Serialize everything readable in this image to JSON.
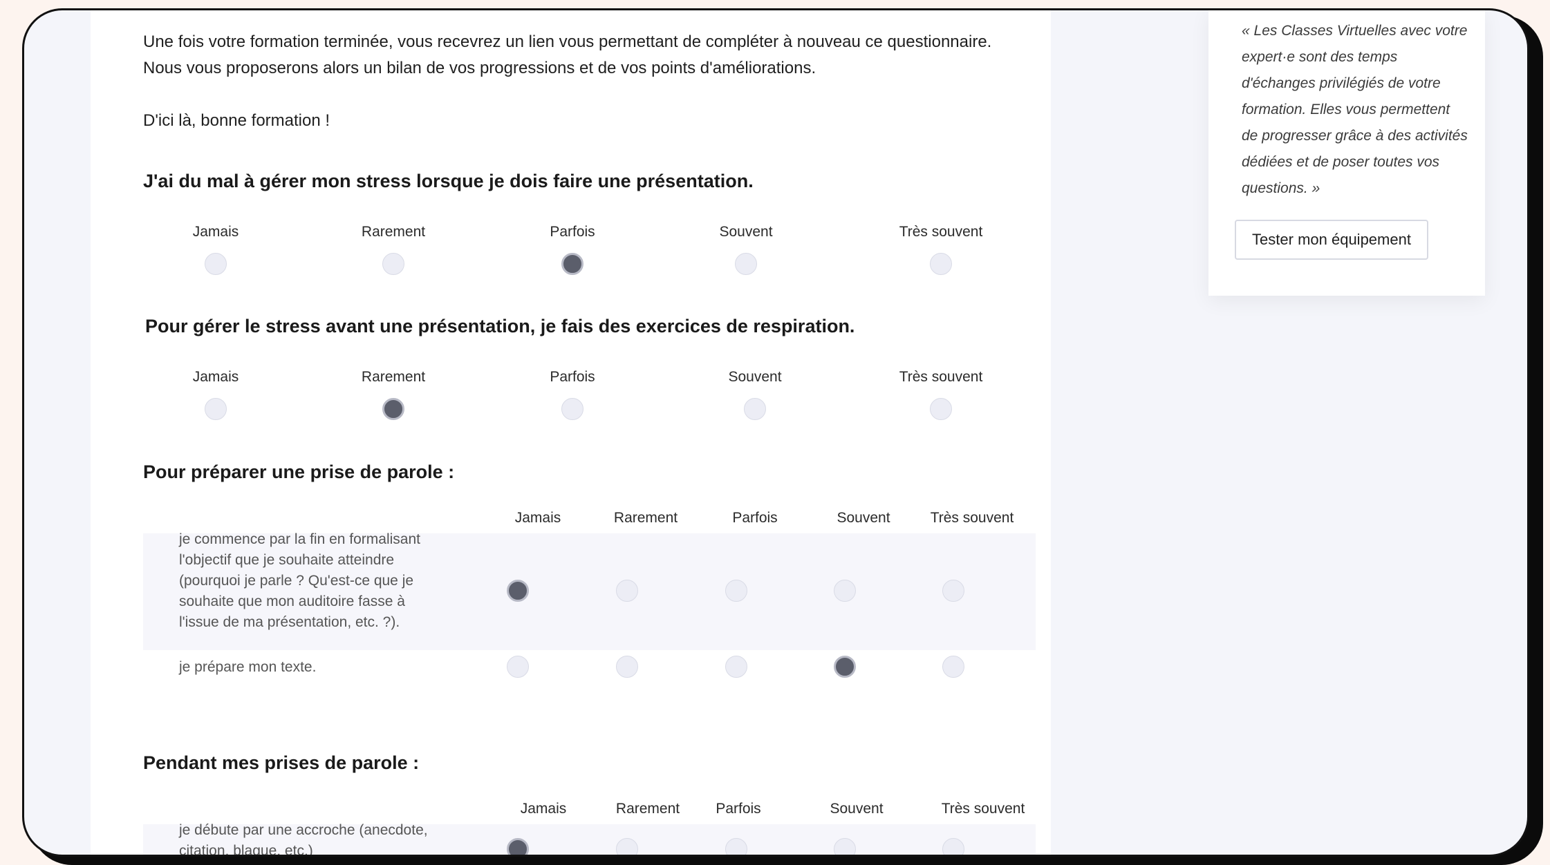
{
  "intro": {
    "line1": "Une fois votre formation terminée, vous recevrez un lien vous permettant de compléter à nouveau ce questionnaire.",
    "line2": "Nous vous proposerons alors un bilan de vos progressions et de vos points d'améliorations.",
    "line3": "D'ici là, bonne formation !"
  },
  "options": [
    "Jamais",
    "Rarement",
    "Parfois",
    "Souvent",
    "Très souvent"
  ],
  "q1": {
    "title": "J'ai du mal à gérer mon stress lorsque je dois faire une présentation.",
    "selected": "Parfois"
  },
  "q2": {
    "title": "Pour gérer le stress avant une présentation, je fais des exercices de respiration.",
    "selected": "Rarement"
  },
  "q3": {
    "title": "Pour préparer une prise de parole :",
    "rows": [
      {
        "text": "je commence par la fin en formalisant l'objectif que je souhaite atteindre (pourquoi je parle ? Qu'est-ce que je souhaite que mon auditoire fasse à l'issue de ma présentation, etc. ?).",
        "selected": "Jamais"
      },
      {
        "text": "je prépare mon texte.",
        "selected": "Souvent"
      }
    ]
  },
  "q4": {
    "title": "Pendant mes prises de parole :",
    "rows": [
      {
        "text": "je débute par une accroche (anecdote, citation, blague, etc.)",
        "selected": "Jamais"
      }
    ]
  },
  "sidebar": {
    "quote": "« Les Classes Virtuelles avec votre expert·e sont des temps d'échanges privilégiés de votre formation. Elles vous permettent de progresser grâce à des activités dédiées et de poser toutes vos questions. »",
    "button_label": "Tester mon équipement"
  },
  "colors": {
    "radio_checked": "#5b5e6b",
    "radio_empty": "#ecedf5",
    "page_bg": "#f4f5fa",
    "outer_bg": "#fdf4ef"
  }
}
